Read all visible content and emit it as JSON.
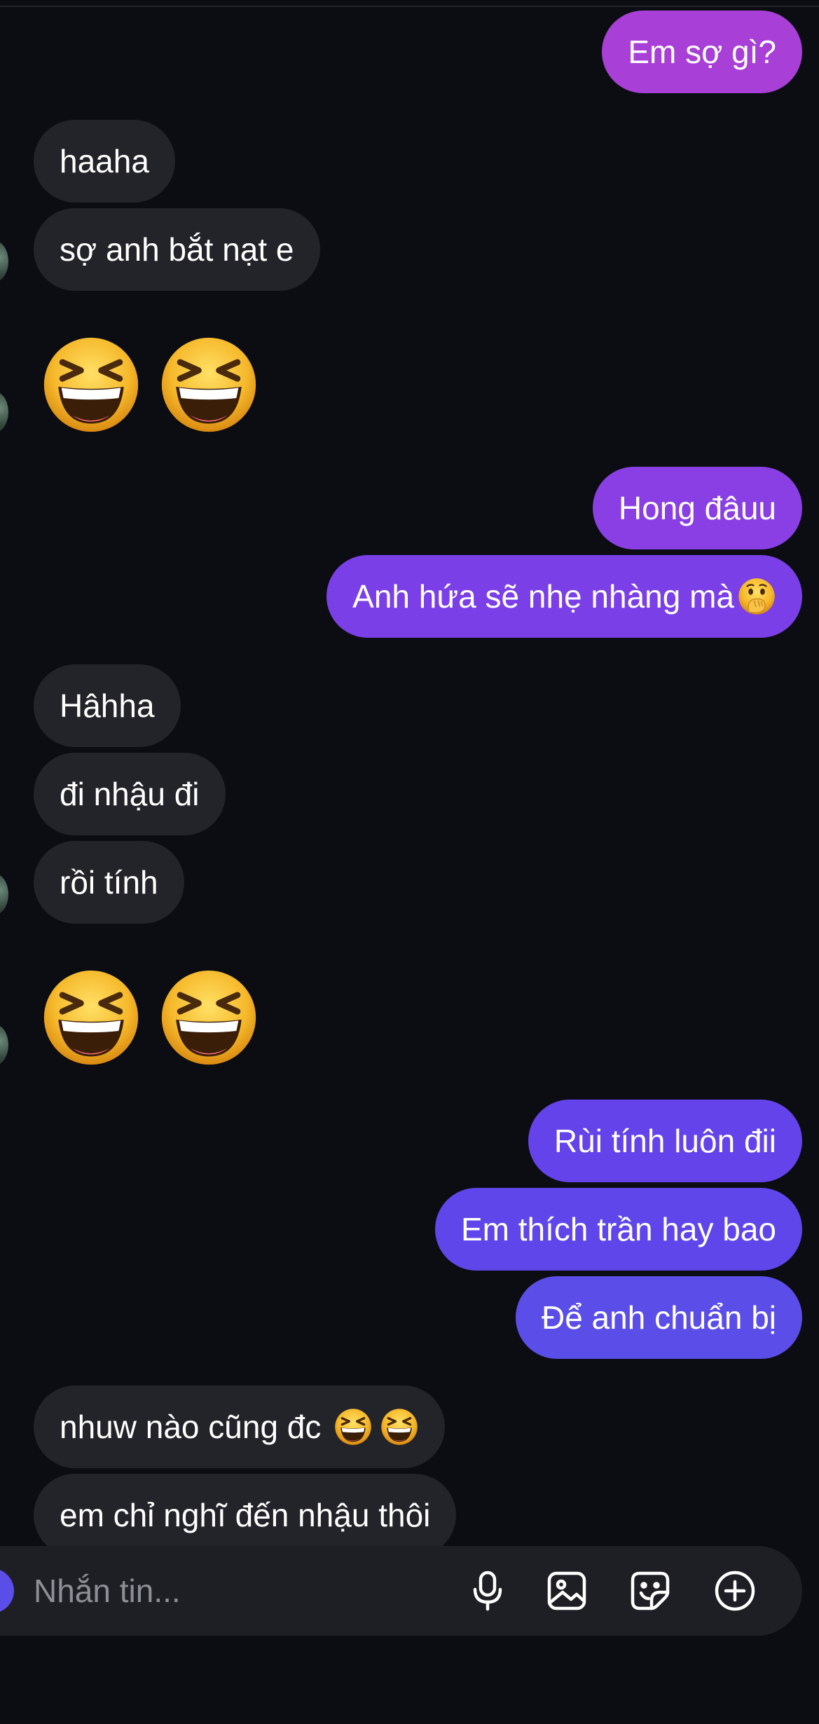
{
  "messages": [
    {
      "id": "m1",
      "side": "out",
      "text": "Em sợ gì?"
    },
    {
      "id": "m2",
      "side": "in",
      "text": "haaha"
    },
    {
      "id": "m3",
      "side": "in",
      "text": "sợ anh bắt nạt e"
    },
    {
      "id": "m4",
      "side": "in",
      "type": "emoji",
      "emoji": "laughing-squinting-face",
      "count": 2
    },
    {
      "id": "m5",
      "side": "out",
      "text": "Hong đâuu"
    },
    {
      "id": "m6",
      "side": "out",
      "text": "Anh hứa sẽ nhẹ nhàng mà",
      "emoji_suffix": "face-with-hand-over-mouth"
    },
    {
      "id": "m7",
      "side": "in",
      "text": "Hâhha"
    },
    {
      "id": "m8",
      "side": "in",
      "text": "đi nhậu đi"
    },
    {
      "id": "m9",
      "side": "in",
      "text": "rồi tính"
    },
    {
      "id": "m10",
      "side": "in",
      "type": "emoji",
      "emoji": "laughing-squinting-face",
      "count": 2
    },
    {
      "id": "m11",
      "side": "out",
      "text": "Rùi tính luôn đii"
    },
    {
      "id": "m12",
      "side": "out",
      "text": "Em thích trần hay bao"
    },
    {
      "id": "m13",
      "side": "out",
      "text": "Để anh chuẩn bị"
    },
    {
      "id": "m14",
      "side": "in",
      "text": "nhuw nào cũng đc",
      "emoji_suffix": "laughing-squinting-face",
      "emoji_suffix_count": 2
    },
    {
      "id": "m15",
      "side": "in",
      "text": "em chỉ nghĩ đến nhậu thôi"
    }
  ],
  "composer": {
    "placeholder": "Nhắn tin...",
    "icons": [
      "microphone-icon",
      "image-icon",
      "sticker-icon",
      "add-icon"
    ]
  },
  "colors": {
    "background": "#0c0d12",
    "incoming_bubble": "#232429",
    "outgoing_top": "#a83fd6",
    "outgoing_mid": "#7b3fe8",
    "outgoing_bottom": "#5b4ee8",
    "text": "#ffffff",
    "placeholder": "#8d8f96",
    "composer_bg": "#1e1f24"
  }
}
